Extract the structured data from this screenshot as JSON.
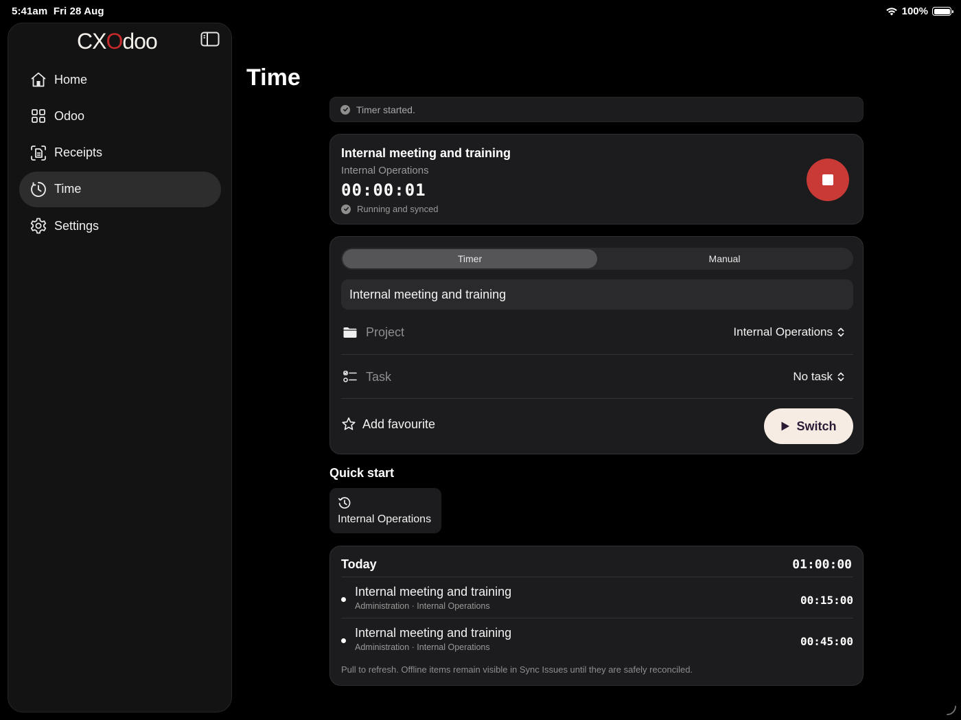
{
  "status_bar": {
    "time": "5:41am",
    "date": "Fri 28 Aug",
    "battery": "100%",
    "battery_level": 1.0
  },
  "sidebar": {
    "logo": {
      "prefix": "CX",
      "middle": "O",
      "suffix": "doo"
    },
    "items": [
      {
        "label": "Home",
        "icon": "home-icon",
        "active": false
      },
      {
        "label": "Odoo",
        "icon": "grid-icon",
        "active": false
      },
      {
        "label": "Receipts",
        "icon": "receipt-scan-icon",
        "active": false
      },
      {
        "label": "Time",
        "icon": "clock-icon",
        "active": true
      },
      {
        "label": "Settings",
        "icon": "gear-icon",
        "active": false
      }
    ]
  },
  "page": {
    "title": "Time"
  },
  "toast": {
    "text": "Timer started."
  },
  "running": {
    "title": "Internal meeting and training",
    "project": "Internal Operations",
    "elapsed": "00:00:01",
    "status": "Running and synced"
  },
  "form": {
    "modes": [
      "Timer",
      "Manual"
    ],
    "active_mode": "Timer",
    "description_value": "Internal meeting and training",
    "project_label": "Project",
    "project_value": "Internal Operations",
    "task_label": "Task",
    "task_value": "No task",
    "favourite_label": "Add favourite",
    "switch_label": "Switch"
  },
  "quick_start": {
    "title": "Quick start",
    "items": [
      {
        "label": "Internal Operations",
        "icon": "history-icon"
      }
    ]
  },
  "today": {
    "title": "Today",
    "total": "01:00:00",
    "entries": [
      {
        "name": "Internal meeting and training",
        "meta": "Administration · Internal Operations",
        "duration": "00:15:00"
      },
      {
        "name": "Internal meeting and training",
        "meta": "Administration · Internal Operations",
        "duration": "00:45:00"
      }
    ],
    "footer": "Pull to refresh. Offline items remain visible in Sync Issues until they are safely reconciled."
  },
  "colors": {
    "accent_stop": "#c93a36",
    "switch_bg": "#f6ece4",
    "background": "#000000",
    "card": "#1c1c1e"
  }
}
